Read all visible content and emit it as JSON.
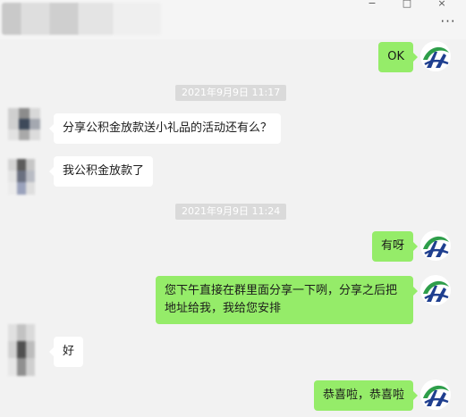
{
  "window": {
    "minimize_glyph": "−",
    "maximize_glyph": "□",
    "more_glyph": "···"
  },
  "messages": [
    {
      "type": "outgoing",
      "text": "OK"
    },
    {
      "type": "timestamp",
      "text": "2021年9月9日 11:17"
    },
    {
      "type": "incoming",
      "text": "分享公积金放款送小礼品的活动还有么？"
    },
    {
      "type": "incoming",
      "text": "我公积金放款了"
    },
    {
      "type": "timestamp",
      "text": "2021年9月9日 11:24"
    },
    {
      "type": "outgoing",
      "text": "有呀"
    },
    {
      "type": "outgoing",
      "text": "您下午直接在群里面分享一下咧，分享之后把地址给我，我给您安排"
    },
    {
      "type": "incoming",
      "text": "好"
    },
    {
      "type": "outgoing",
      "text": "恭喜啦，恭喜啦"
    }
  ],
  "colors": {
    "chat_bg": "#f2f2f2",
    "outgoing_bubble": "#95ec69",
    "incoming_bubble": "#ffffff",
    "timestamp_bg": "#dadada",
    "logo_green": "#2e9e4a",
    "logo_blue": "#1f3f8f"
  },
  "icons": {
    "self_avatar": "green-blue-swoosh-logo-icon",
    "other_avatar": "pixelated-avatar-icon"
  }
}
